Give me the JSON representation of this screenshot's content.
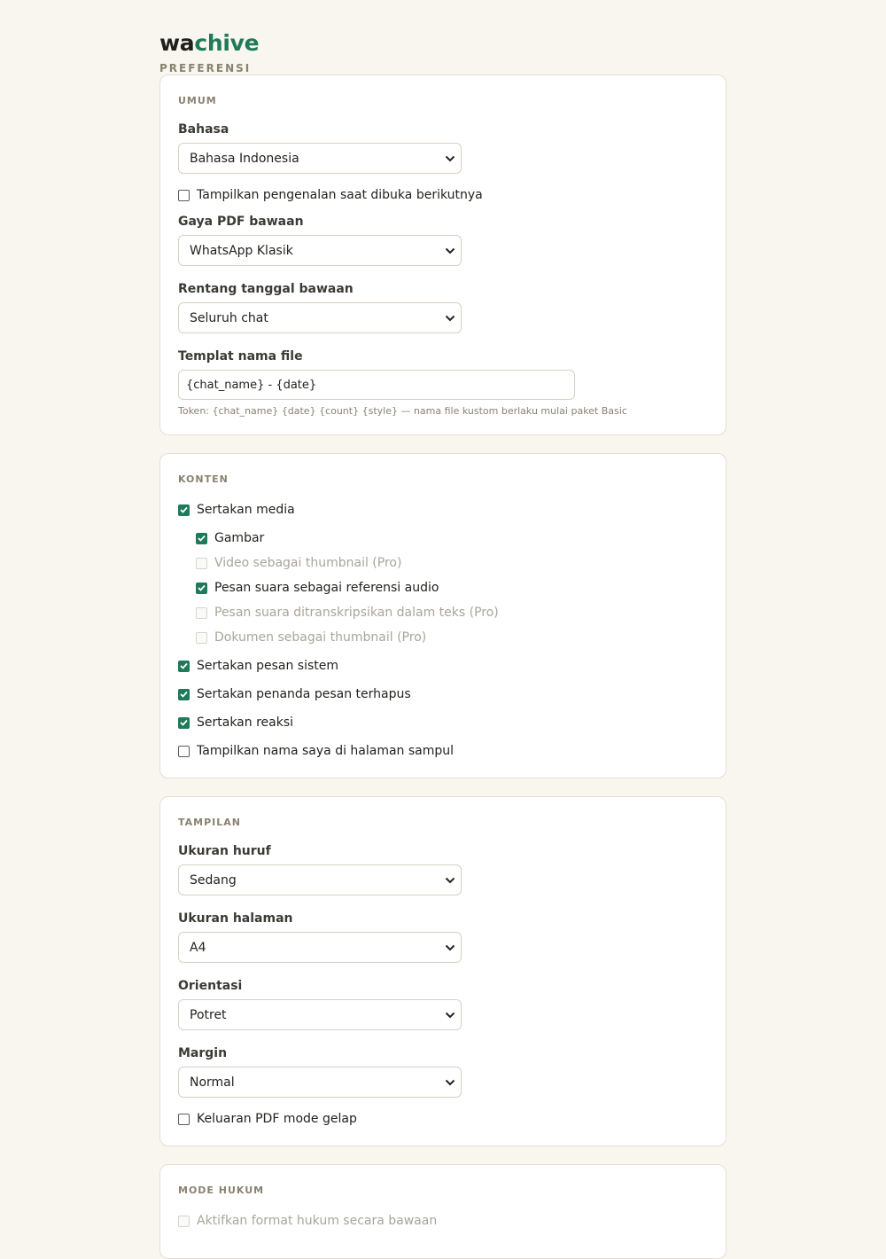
{
  "brand": {
    "part1": "wa",
    "part2": "chive",
    "subtitle": "PREFERENSI"
  },
  "colors": {
    "accent": "#1f7a5a",
    "background": "#f8f6ef",
    "muted": "#8a8270"
  },
  "general": {
    "title": "UMUM",
    "language_label": "Bahasa",
    "language_value": "Bahasa Indonesia",
    "show_intro_label": "Tampilkan pengenalan saat dibuka berikutnya",
    "show_intro_checked": false,
    "pdf_style_label": "Gaya PDF bawaan",
    "pdf_style_value": "WhatsApp Klasik",
    "date_range_label": "Rentang tanggal bawaan",
    "date_range_value": "Seluruh chat",
    "filename_label": "Templat nama file",
    "filename_value": "{chat_name} - {date}",
    "filename_hint": "Token: {chat_name} {date} {count} {style} — nama file kustom berlaku mulai paket Basic"
  },
  "content": {
    "title": "KONTEN",
    "include_media": "Sertakan media",
    "images": "Gambar",
    "video_thumbnail": "Video sebagai thumbnail (Pro)",
    "voice_audio_ref": "Pesan suara sebagai referensi audio",
    "voice_transcribed": "Pesan suara ditranskripsikan dalam teks (Pro)",
    "document_thumbnail": "Dokumen sebagai thumbnail (Pro)",
    "system_messages": "Sertakan pesan sistem",
    "deleted_markers": "Sertakan penanda pesan terhapus",
    "reactions": "Sertakan reaksi",
    "cover_name": "Tampilkan nama saya di halaman sampul"
  },
  "display": {
    "title": "TAMPILAN",
    "font_size_label": "Ukuran huruf",
    "font_size_value": "Sedang",
    "page_size_label": "Ukuran halaman",
    "page_size_value": "A4",
    "orientation_label": "Orientasi",
    "orientation_value": "Potret",
    "margin_label": "Margin",
    "margin_value": "Normal",
    "dark_pdf_label": "Keluaran PDF mode gelap"
  },
  "legal": {
    "title": "MODE HUKUM",
    "enable_label": "Aktifkan format hukum secara bawaan"
  }
}
